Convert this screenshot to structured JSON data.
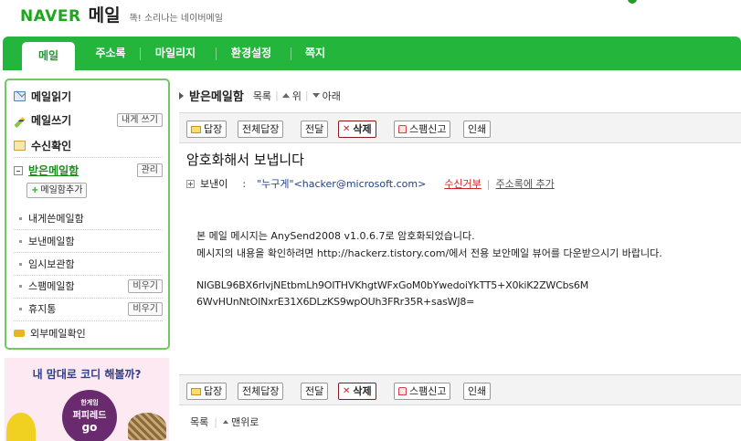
{
  "header": {
    "logo_naver": "NAVER",
    "logo_mail": "메일",
    "slogan": "똑! 소리나는 네이버메일"
  },
  "nav": {
    "tabs": [
      {
        "label": "메일",
        "active": true
      },
      {
        "label": "주소록",
        "active": false
      },
      {
        "label": "마일리지",
        "active": false
      },
      {
        "label": "환경설정",
        "active": false
      },
      {
        "label": "쪽지",
        "active": false
      }
    ]
  },
  "sidebar": {
    "read_mail": "메일읽기",
    "write_mail": "메일쓰기",
    "write_to_me": "내게 쓰기",
    "receipt_check": "수신확인",
    "inbox": "받은메일함",
    "manage": "관리",
    "add_mailbox": "메일함추가",
    "folders": [
      {
        "label": "내게쓴메일함",
        "button": ""
      },
      {
        "label": "보낸메일함",
        "button": ""
      },
      {
        "label": "임시보관함",
        "button": ""
      },
      {
        "label": "스팸메일함",
        "button": "비우기"
      },
      {
        "label": "휴지통",
        "button": "비우기"
      }
    ],
    "external_mail": "외부메일확인"
  },
  "ad": {
    "headline": "내 맘대로 코디 해볼까?",
    "badge_line1": "한게임",
    "badge_line2": "퍼피레드",
    "badge_line3": "go"
  },
  "main": {
    "folder_title": "받은메일함",
    "nav_list": "목록",
    "nav_up": "위",
    "nav_down": "아래",
    "toolbar": {
      "reply": "답장",
      "reply_all": "전체답장",
      "forward": "전달",
      "delete": "삭제",
      "report_spam": "스팸신고",
      "print": "인쇄"
    },
    "subject": "암호화해서 보냅니다",
    "sender_label": "보낸이",
    "sender_colon": ":",
    "sender_value": "\"누구게\"<hacker@microsoft.com>",
    "reject": "수신거부",
    "add_to_contacts": "주소록에 추가",
    "body_line1": "본 메일 메시지는 AnySend2008 v1.0.6.7로 암호화되었습니다.",
    "body_line2": "메시지의 내용을 확인하려면 http://hackerz.tistory.com/에서 전용 보안메일 뷰어를 다운받으시기 바랍니다.",
    "code_line1": "NIGBL96BX6rlvjNEtbmLh9OITHVKhgtWFxGoM0bYwedoiYkTT5+X0kiK2ZWCbs6M",
    "code_line2": "6WvHUnNtOINxrE31X6DLzKS9wpOUh3FRr35R+sasWJ8=",
    "bottom_list": "목록",
    "bottom_top": "맨위로"
  },
  "colors": {
    "nav_green": "#24b53d",
    "sidebar_border": "#6fc860",
    "reject_red": "#cc2222"
  }
}
